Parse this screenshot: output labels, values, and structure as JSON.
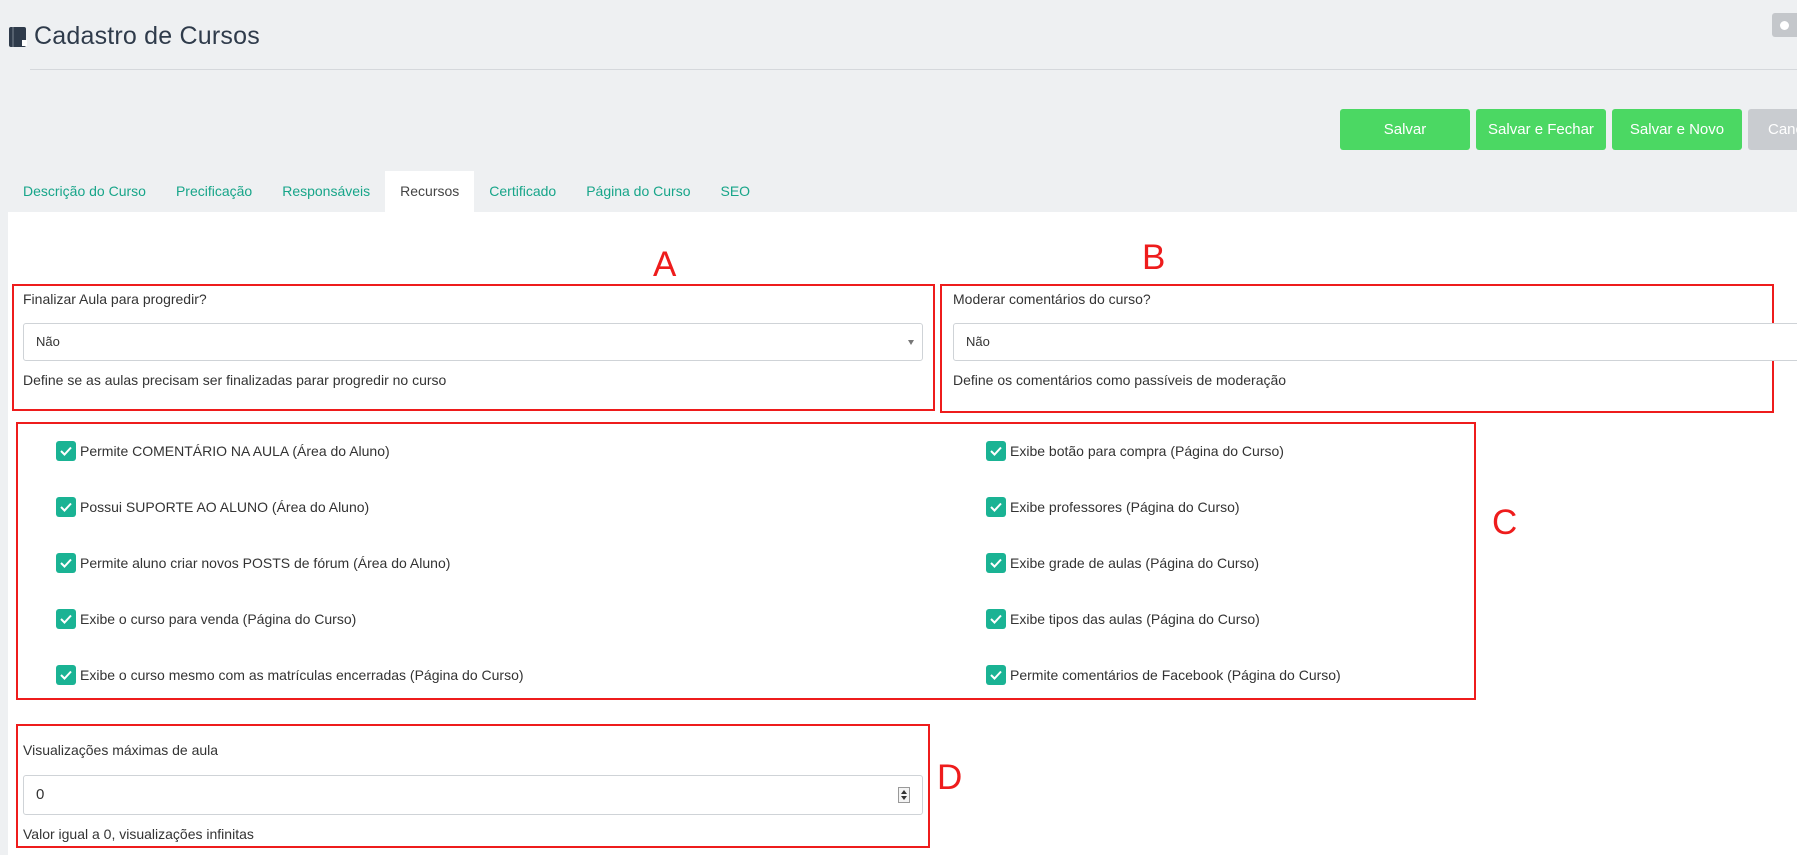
{
  "header": {
    "title": "Cadastro de Cursos"
  },
  "actions": {
    "save": "Salvar",
    "save_close": "Salvar e Fechar",
    "save_new": "Salvar e Novo",
    "cancel": "Canc"
  },
  "tabs": [
    {
      "label": "Descrição do Curso"
    },
    {
      "label": "Precificação"
    },
    {
      "label": "Responsáveis"
    },
    {
      "label": "Recursos",
      "active": true
    },
    {
      "label": "Certificado"
    },
    {
      "label": "Página do Curso"
    },
    {
      "label": "SEO"
    }
  ],
  "annotations": {
    "a": "A",
    "b": "B",
    "c": "C",
    "d": "D"
  },
  "finish_lesson": {
    "label": "Finalizar Aula para progredir?",
    "value": "Não",
    "help": "Define se as aulas precisam ser finalizadas parar progredir no curso"
  },
  "moderate_comments": {
    "label": "Moderar comentários do curso?",
    "value": "Não",
    "help": "Define os comentários como passíveis de moderação"
  },
  "checkboxes_left": [
    {
      "label": "Permite COMENTÁRIO NA AULA (Área do Aluno)",
      "checked": true
    },
    {
      "label": "Possui SUPORTE AO ALUNO (Área do Aluno)",
      "checked": true
    },
    {
      "label": "Permite aluno criar novos POSTS de fórum (Área do Aluno)",
      "checked": true
    },
    {
      "label": "Exibe o curso para venda (Página do Curso)",
      "checked": true
    },
    {
      "label": "Exibe o curso mesmo com as matrículas encerradas (Página do Curso)",
      "checked": true
    }
  ],
  "checkboxes_right": [
    {
      "label": "Exibe botão para compra (Página do Curso)",
      "checked": true
    },
    {
      "label": "Exibe professores (Página do Curso)",
      "checked": true
    },
    {
      "label": "Exibe grade de aulas (Página do Curso)",
      "checked": true
    },
    {
      "label": "Exibe tipos das aulas (Página do Curso)",
      "checked": true
    },
    {
      "label": "Permite comentários de Facebook (Página do Curso)",
      "checked": true
    }
  ],
  "max_views": {
    "label": "Visualizações máximas de aula",
    "value": "0",
    "help": "Valor igual a 0, visualizações infinitas"
  },
  "colors": {
    "accent_green": "#4bd863",
    "checkbox_teal": "#1ab394",
    "tab_link": "#17a589",
    "annotation_red": "#ee1c1c"
  }
}
